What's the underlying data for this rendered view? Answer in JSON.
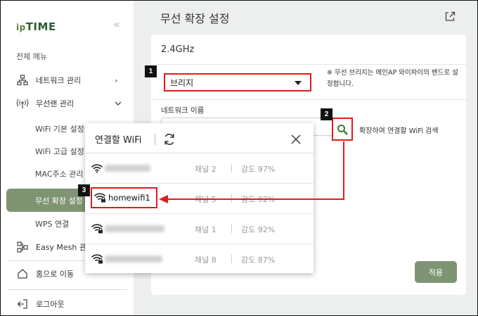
{
  "sidebar": {
    "logo": {
      "prefix": "ip",
      "main": "TIME"
    },
    "collapse_glyph": "«",
    "menu_all": "전체 메뉴",
    "items": [
      {
        "label": "네트워크 관리",
        "icon": "network-icon",
        "chevron": "›"
      },
      {
        "label": "무선랜 관리",
        "icon": "wireless-icon",
        "chevron": "⌄"
      }
    ],
    "subitems": [
      "WiFi 기본 설정",
      "WiFi 고급 설정",
      "MAC주소 관리",
      "무선 확장 설정",
      "WPS 연결"
    ],
    "lower_items": [
      {
        "label": "Easy Mesh 관리",
        "icon": "mesh-icon"
      },
      {
        "label": "홈으로 이동",
        "icon": "home-icon"
      },
      {
        "label": "로그아웃",
        "icon": "logout-icon"
      }
    ]
  },
  "main": {
    "title": "무선 확장 설정",
    "band": "2.4GHz",
    "mode_value": "브리지",
    "note": "※ 무선 브리지는 메인AP 와이파이의 밴드로 설정합니다.",
    "netname_label": "네트워크 이름",
    "search_label": "확장하여 연결할 WiFi 검색",
    "apply_label": "적용"
  },
  "popup": {
    "title": "연결할 WiFi",
    "rows": [
      {
        "ssid": "",
        "channel": "채널 2",
        "sensitivity": "감도 97%",
        "locked": false
      },
      {
        "ssid": "homewifi1",
        "channel": "채널 5",
        "sensitivity": "감도 92%",
        "locked": true
      },
      {
        "ssid": "",
        "channel": "채널 1",
        "sensitivity": "감도 92%",
        "locked": true
      },
      {
        "ssid": "",
        "channel": "채널 8",
        "sensitivity": "감도 87%",
        "locked": true
      }
    ]
  },
  "badges": [
    "1",
    "2",
    "3"
  ],
  "colors": {
    "accent": "#7f9473",
    "highlight": "#e31b1b",
    "background": "#ecefed"
  }
}
